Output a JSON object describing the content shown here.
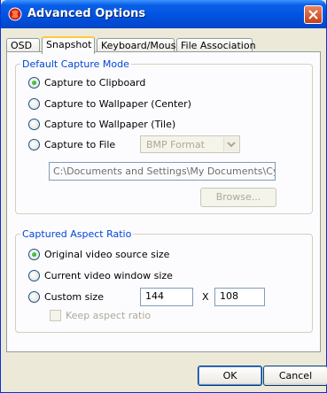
{
  "window": {
    "title": "Advanced Options"
  },
  "tabs": [
    {
      "label": "OSD"
    },
    {
      "label": "Snapshot"
    },
    {
      "label": "Keyboard/Mouse"
    },
    {
      "label": "File Association"
    }
  ],
  "capture_mode": {
    "legend": "Default Capture Mode",
    "options": [
      {
        "label": "Capture to Clipboard",
        "selected": true
      },
      {
        "label": "Capture to Wallpaper (Center)",
        "selected": false
      },
      {
        "label": "Capture to Wallpaper (Tile)",
        "selected": false
      },
      {
        "label": "Capture to File",
        "selected": false
      }
    ],
    "format": {
      "value": "BMP Format",
      "enabled": false
    },
    "path": {
      "value": "C:\\Documents and Settings\\My Documents\\CyberLin",
      "enabled": false
    },
    "browse_label": "Browse..."
  },
  "aspect_ratio": {
    "legend": "Captured Aspect Ratio",
    "options": [
      {
        "label": "Original video source size",
        "selected": true
      },
      {
        "label": "Current video window size",
        "selected": false
      },
      {
        "label": "Custom size",
        "selected": false
      }
    ],
    "width": "144",
    "times": "X",
    "height": "108",
    "keep_aspect": {
      "label": "Keep aspect ratio",
      "checked": false,
      "enabled": false
    }
  },
  "buttons": {
    "ok": "OK",
    "cancel": "Cancel"
  },
  "colors": {
    "titlebar": "#0053e0",
    "group_label": "#0046d5",
    "tab_highlight": "#ffc83c",
    "dialog_bg": "#ece9d8"
  }
}
